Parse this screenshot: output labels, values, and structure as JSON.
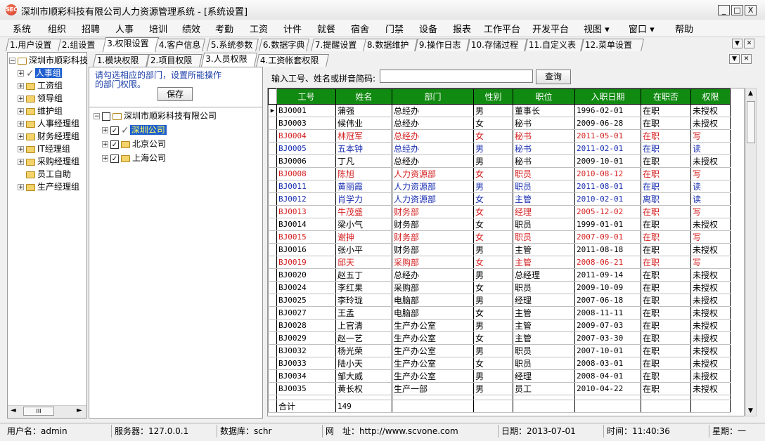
{
  "window": {
    "app_icon_text": "SEC",
    "title": "深圳市顺彩科技有限公司人力资源管理系统 - [系统设置]",
    "btn_minimize": "_",
    "btn_maximize": "□",
    "btn_close": "X"
  },
  "menu": [
    "系统",
    "组织",
    "招聘",
    "人事",
    "培训",
    "绩效",
    "考勤",
    "工资",
    "计件",
    "就餐",
    "宿舍",
    "门禁",
    "设备",
    "报表",
    "工作平台",
    "开发平台",
    "视图 ▾",
    "窗口 ▾",
    "帮助"
  ],
  "main_tabs": [
    "1.用户设置",
    "2.组设置",
    "3.权限设置",
    "4.客户信息",
    "5.系统参数",
    "6.数据字典",
    "7.提醒设置",
    "8.数据维护",
    "9.操作日志",
    "10.存储过程",
    "11.自定义表",
    "12.菜单设置"
  ],
  "main_tabs_active": 2,
  "left_tree": {
    "root": "深圳市顺彩科技",
    "items": [
      {
        "label": "人事组",
        "selected": true,
        "checked": true,
        "expand": true
      },
      {
        "label": "工资组",
        "expand": true
      },
      {
        "label": "领导组",
        "expand": true
      },
      {
        "label": "维护组",
        "expand": true
      },
      {
        "label": "人事经理组",
        "expand": true
      },
      {
        "label": "财务经理组",
        "expand": true
      },
      {
        "label": "IT经理组",
        "expand": true
      },
      {
        "label": "采购经理组",
        "expand": true
      },
      {
        "label": "员工自助",
        "expand": false
      },
      {
        "label": "生产经理组",
        "expand": true
      }
    ],
    "scroll_thumb": "III"
  },
  "sub_tabs": [
    "1.模块权限",
    "2.项目权限",
    "3.人员权限",
    "4.工资帐套权限"
  ],
  "sub_tabs_active": 2,
  "mid": {
    "hint": "请勾选相应的部门，设置所能操作的部门权限。",
    "save_label": "保存",
    "company": "深圳市顺彩科技有限公司",
    "branches": [
      {
        "label": "深圳公司",
        "selected": true
      },
      {
        "label": "北京公司"
      },
      {
        "label": "上海公司"
      }
    ]
  },
  "search": {
    "label": "输入工号、姓名或拼音简码:",
    "value": "",
    "button": "查询"
  },
  "table": {
    "columns": [
      "工号",
      "姓名",
      "部门",
      "性别",
      "职位",
      "入职日期",
      "在职否",
      "权限"
    ],
    "rows": [
      {
        "c": "black",
        "cells": [
          "BJ0001",
          "蒲强",
          "总经办",
          "男",
          "董事长",
          "1996-02-01",
          "在职",
          "未授权"
        ]
      },
      {
        "c": "black",
        "cells": [
          "BJ0003",
          "候伟业",
          "总经办",
          "女",
          "秘书",
          "2009-06-28",
          "在职",
          "未授权"
        ]
      },
      {
        "c": "red",
        "cells": [
          "BJ0004",
          "林冠军",
          "总经办",
          "女",
          "秘书",
          "2011-05-01",
          "在职",
          "写"
        ]
      },
      {
        "c": "blue",
        "cells": [
          "BJ0005",
          "五本钟",
          "总经办",
          "男",
          "秘书",
          "2011-02-01",
          "在职",
          "读"
        ]
      },
      {
        "c": "black",
        "cells": [
          "BJ0006",
          "丁凡",
          "总经办",
          "男",
          "秘书",
          "2009-10-01",
          "在职",
          "未授权"
        ]
      },
      {
        "c": "red",
        "cells": [
          "BJ0008",
          "陈旭",
          "人力资源部",
          "女",
          "职员",
          "2010-08-12",
          "在职",
          "写"
        ]
      },
      {
        "c": "blue",
        "cells": [
          "BJ0011",
          "黄丽霞",
          "人力资源部",
          "男",
          "职员",
          "2011-08-01",
          "在职",
          "读"
        ]
      },
      {
        "c": "blue",
        "cells": [
          "BJ0012",
          "肖学力",
          "人力资源部",
          "女",
          "主管",
          "2010-02-01",
          "离职",
          "读"
        ]
      },
      {
        "c": "red",
        "cells": [
          "BJ0013",
          "牛茂盛",
          "财务部",
          "女",
          "经理",
          "2005-12-02",
          "在职",
          "写"
        ]
      },
      {
        "c": "black",
        "cells": [
          "BJ0014",
          "梁小气",
          "财务部",
          "女",
          "职员",
          "1999-01-01",
          "在职",
          "未授权"
        ]
      },
      {
        "c": "red",
        "cells": [
          "BJ0015",
          "谢抻",
          "财务部",
          "女",
          "职员",
          "2007-09-01",
          "在职",
          "写"
        ]
      },
      {
        "c": "black",
        "cells": [
          "BJ0016",
          "张小平",
          "财务部",
          "男",
          "主管",
          "2011-08-18",
          "在职",
          "未授权"
        ]
      },
      {
        "c": "red",
        "cells": [
          "BJ0019",
          "邱天",
          "采购部",
          "女",
          "主管",
          "2008-06-21",
          "在职",
          "写"
        ]
      },
      {
        "c": "black",
        "cells": [
          "BJ0020",
          "赵五丁",
          "总经办",
          "男",
          "总经理",
          "2011-09-14",
          "在职",
          "未授权"
        ]
      },
      {
        "c": "black",
        "cells": [
          "BJ0024",
          "李红果",
          "采购部",
          "女",
          "职员",
          "2009-10-09",
          "在职",
          "未授权"
        ]
      },
      {
        "c": "black",
        "cells": [
          "BJ0025",
          "李玲珑",
          "电脑部",
          "男",
          "经理",
          "2007-06-18",
          "在职",
          "未授权"
        ]
      },
      {
        "c": "black",
        "cells": [
          "BJ0027",
          "王孟",
          "电脑部",
          "女",
          "主管",
          "2008-11-11",
          "在职",
          "未授权"
        ]
      },
      {
        "c": "black",
        "cells": [
          "BJ0028",
          "上官清",
          "生产办公室",
          "男",
          "主管",
          "2009-07-03",
          "在职",
          "未授权"
        ]
      },
      {
        "c": "black",
        "cells": [
          "BJ0029",
          "赵一艺",
          "生产办公室",
          "女",
          "主管",
          "2007-03-30",
          "在职",
          "未授权"
        ]
      },
      {
        "c": "black",
        "cells": [
          "BJ0032",
          "杨光荣",
          "生产办公室",
          "男",
          "职员",
          "2007-10-01",
          "在职",
          "未授权"
        ]
      },
      {
        "c": "black",
        "cells": [
          "BJ0033",
          "陆小天",
          "生产办公室",
          "女",
          "职员",
          "2008-03-01",
          "在职",
          "未授权"
        ]
      },
      {
        "c": "black",
        "cells": [
          "BJ0034",
          "邹大威",
          "生产办公室",
          "男",
          "经理",
          "2008-04-01",
          "在职",
          "未授权"
        ]
      },
      {
        "c": "black",
        "cells": [
          "BJ0035",
          "黄长权",
          "生产一部",
          "男",
          "员工",
          "2010-04-22",
          "在职",
          "未授权"
        ]
      }
    ],
    "footer_label": "合计",
    "footer_count": "149",
    "current_row_marker": "▶"
  },
  "status": [
    "用户名：admin",
    "服务器：127.0.0.1",
    "数据库：schr",
    "网　址：http://www.scvone.com",
    "日期：2013-07-01",
    "时间：11:40:36",
    "星期：一"
  ],
  "colors": {
    "header_green": "#118a11",
    "red_row": "#d42020",
    "blue_row": "#1a2fb0"
  }
}
